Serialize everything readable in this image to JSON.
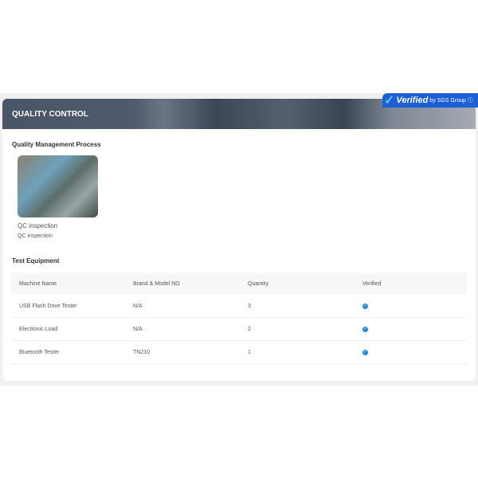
{
  "header": {
    "title": "QUALITY CONTROL"
  },
  "badge": {
    "verified": "Verified",
    "by": "by SGS Group",
    "info": "ⓘ"
  },
  "process": {
    "heading": "Quality Management Process",
    "items": [
      {
        "title": "QC inspection",
        "subtitle": "QC inspection"
      }
    ]
  },
  "equipment": {
    "heading": "Test Equipment",
    "columns": [
      "Machine Name",
      "Brand & Model NO",
      "Quantity",
      "Verified"
    ],
    "rows": [
      [
        "USB Flash Drive Tester",
        "N/A",
        "3"
      ],
      [
        "Electronic Load",
        "N/A",
        "2"
      ],
      [
        "Bluetooth Tester",
        "TN210",
        "1"
      ]
    ]
  },
  "colors": {
    "accent": "#1e88e5",
    "badge": "#1a5fd6"
  }
}
